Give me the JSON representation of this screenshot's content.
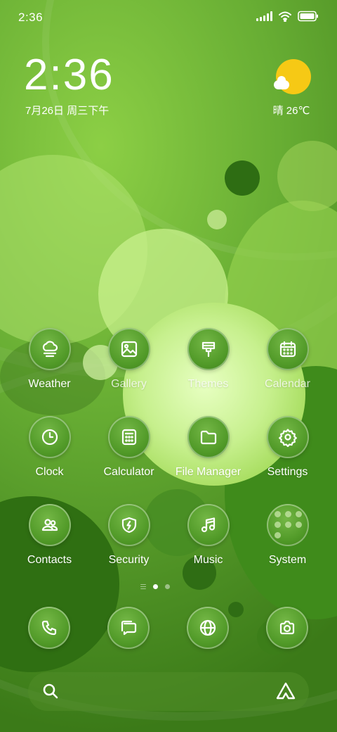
{
  "status_bar": {
    "time": "2:36"
  },
  "clock_widget": {
    "time": "2:36",
    "date": "7月26日 周三下午"
  },
  "weather_widget": {
    "temperature": "晴 26℃",
    "icon": "sun-cloud-icon"
  },
  "apps": [
    {
      "label": "Weather",
      "icon": "weather-icon"
    },
    {
      "label": "Gallery",
      "icon": "gallery-icon"
    },
    {
      "label": "Themes",
      "icon": "themes-icon"
    },
    {
      "label": "Calendar",
      "icon": "calendar-icon"
    },
    {
      "label": "Clock",
      "icon": "clock-icon"
    },
    {
      "label": "Calculator",
      "icon": "calculator-icon"
    },
    {
      "label": "File Manager",
      "icon": "folder-icon"
    },
    {
      "label": "Settings",
      "icon": "gear-icon"
    },
    {
      "label": "Contacts",
      "icon": "contacts-icon"
    },
    {
      "label": "Security",
      "icon": "shield-icon"
    },
    {
      "label": "Music",
      "icon": "music-icon"
    },
    {
      "label": "System",
      "icon": "folder-grid-icon"
    }
  ],
  "dock": [
    {
      "icon": "phone-icon"
    },
    {
      "icon": "messages-icon"
    },
    {
      "icon": "browser-icon"
    },
    {
      "icon": "camera-icon"
    }
  ],
  "page_indicator": {
    "pages": 2,
    "current": 1
  },
  "colors": {
    "sun": "#f6c915",
    "icon_bg": "#519a28",
    "wallpaper": "#6fb43a"
  }
}
